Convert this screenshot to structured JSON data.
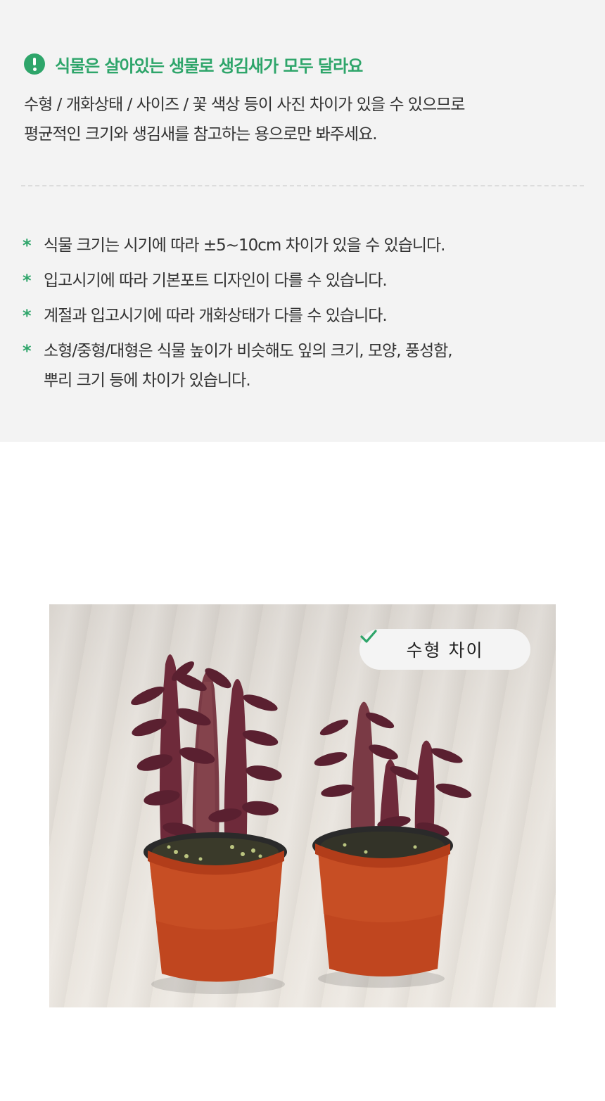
{
  "notice": {
    "icon": "exclamation-icon",
    "accent_color": "#2ea56a",
    "heading": "식물은 살아있는 생물로 생김새가 모두 달라요",
    "intro_lines": [
      "수형 / 개화상태 / 사이즈 / 꽃 색상 등이 사진 차이가 있을 수 있으므로",
      "평균적인 크기와 생김새를 참고하는 용으로만 봐주세요."
    ]
  },
  "bullets": [
    {
      "marker": "*",
      "lines": [
        "식물 크기는 시기에 따라 ±5~10cm 차이가 있을 수 있습니다."
      ]
    },
    {
      "marker": "*",
      "lines": [
        "입고시기에 따라 기본포트 디자인이 다를 수 있습니다."
      ]
    },
    {
      "marker": "*",
      "lines": [
        "계절과 입고시기에 따라 개화상태가 다를 수 있습니다."
      ]
    },
    {
      "marker": "*",
      "lines": [
        "소형/중형/대형은 식물 높이가 비슷해도 잎의 크기, 모양,  풍성함,",
        "뿌리 크기 등에 차이가 있습니다."
      ]
    }
  ],
  "photo": {
    "tag_icon": "check-icon",
    "tag_label": "수형  차이",
    "pot_color": "#c0461f",
    "plant_color": "#6e2a3a"
  }
}
